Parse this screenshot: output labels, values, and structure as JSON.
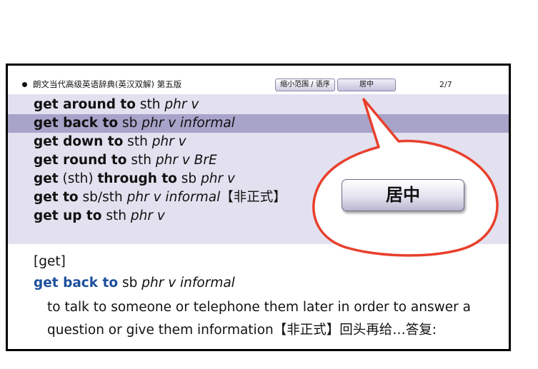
{
  "header": {
    "dictionary_title": "朗文当代高级英语辞典(英汉双解) 第五版",
    "narrow_button_label": "缩小范围 / 语序",
    "center_button_label": "居中",
    "page_indicator": "2/7"
  },
  "entries": [
    {
      "bold": "get around to",
      "plain": " sth ",
      "italic": "phr v"
    },
    {
      "bold": "get back to",
      "plain": " sb ",
      "italic": "phr v informal"
    },
    {
      "bold": "get down to",
      "plain": " sth ",
      "italic": "phr v"
    },
    {
      "bold": "get round to",
      "plain": " sth ",
      "italic": "phr v BrE"
    },
    {
      "bold": "get",
      "plain": " (sth) ",
      "bold2": "through to",
      "plain2": " sb ",
      "italic": "phr v"
    },
    {
      "bold": "get to",
      "plain": " sb/sth ",
      "italic": "phr v informal",
      "tail": "【非正式】"
    },
    {
      "bold": "get up to",
      "plain": " sth ",
      "italic": "phr v"
    }
  ],
  "selected_index": 1,
  "detail": {
    "headword_tag": "[get]",
    "title_bold": "get back to",
    "title_plain": " sb ",
    "title_italic": "phr v informal",
    "definition_line1": "to talk to someone or telephone them later in order to answer a",
    "definition_line2": "question or give them information【非正式】回头再给…答复:"
  },
  "callout": {
    "button_label": "居中",
    "outline_color": "#e8402d"
  },
  "colors": {
    "list_background": "#e3e1ef",
    "selection_background": "#a7a3c9",
    "headword_blue": "#1d4f9c"
  }
}
